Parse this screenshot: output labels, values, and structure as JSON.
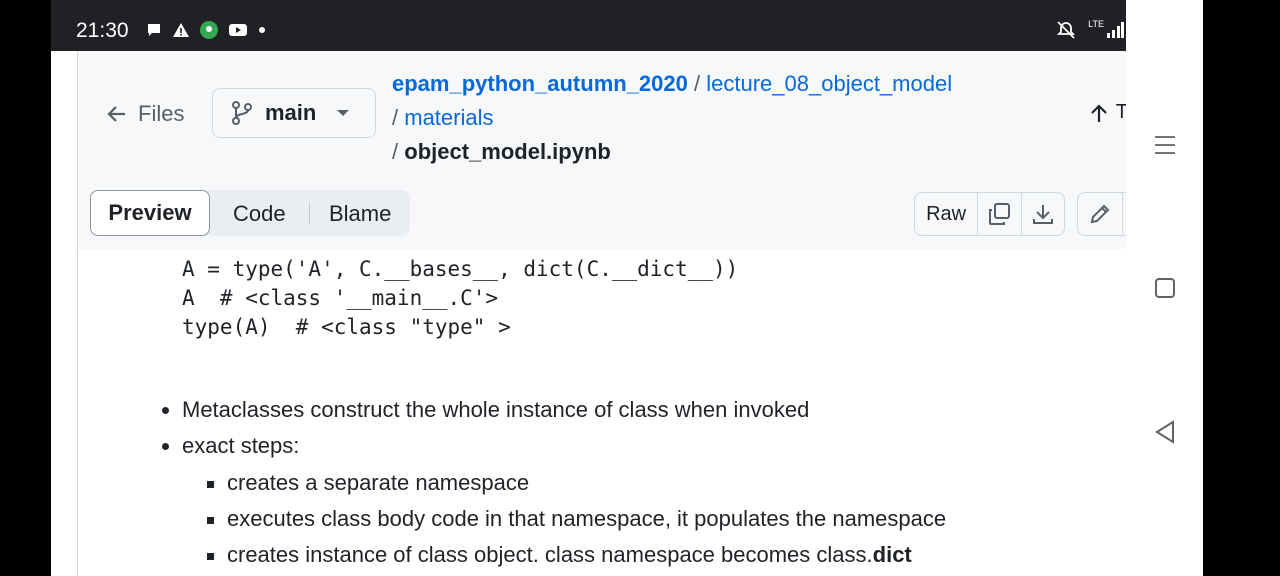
{
  "status": {
    "time": "21:30",
    "network": "LTE"
  },
  "header": {
    "back_label": "Files",
    "branch": "main",
    "crumbs": {
      "repo": "epam_python_autumn_2020",
      "dir1": "lecture_08_object_model",
      "dir2": "materials",
      "file": "object_model.ipynb"
    },
    "top_label": "Top",
    "separator": "/"
  },
  "toolbar": {
    "tabs": [
      "Preview",
      "Code",
      "Blame"
    ],
    "raw_label": "Raw"
  },
  "content": {
    "code_lines": [
      "A = type('A', C.__bases__, dict(C.__dict__))",
      "A  # <class '__main__.C'>",
      "type(A)  # <class \"type\" >"
    ],
    "bullets": [
      "Metaclasses construct the whole instance of class when invoked",
      "exact steps:"
    ],
    "sub_bullets": [
      "creates a separate namespace",
      "executes class body code in that namespace, it populates the namespace",
      "creates instance of class object. class namespace becomes class."
    ],
    "sub_bullet_bold_tail": "dict"
  }
}
